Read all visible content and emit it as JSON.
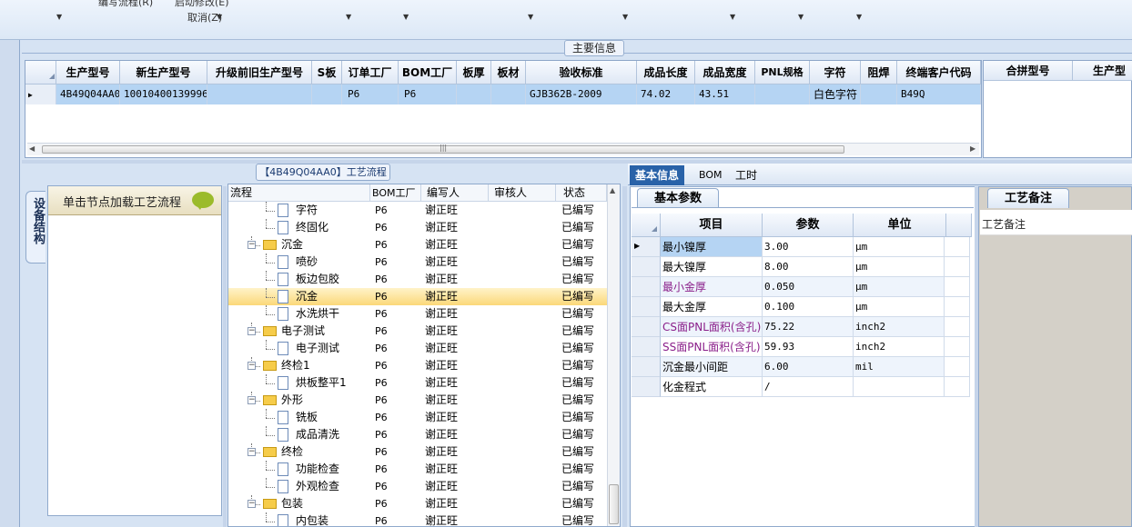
{
  "toolbar": {
    "menu_edit_flow": "编写流程(R)",
    "menu_start_change": "启动修改(E)",
    "menu_cancel": "取消(Z)"
  },
  "main_info": {
    "section_title": "主要信息",
    "columns": [
      "生产型号",
      "新生产型号",
      "升级前旧生产型号",
      "S板",
      "订单工厂",
      "BOM工厂",
      "板厚",
      "板材",
      "验收标准",
      "成品长度",
      "成品宽度",
      "PNL规格",
      "字符",
      "阻焊",
      "终端客户代码"
    ],
    "row": [
      "4B49Q04AA0",
      "10010400139996",
      "",
      "",
      "P6",
      "P6",
      "",
      "",
      "GJB362B-2009",
      "74.02",
      "43.51",
      "",
      "白色字符",
      "",
      "B49Q"
    ],
    "scroll_grip": "|||",
    "right_columns": [
      "合拼型号",
      "生产型"
    ]
  },
  "process": {
    "title": "【4B49Q04AA0】工艺流程",
    "side_tab": "设备结构",
    "load_button": "单击节点加载工艺流程",
    "columns": [
      "流程",
      "BOM工厂",
      "编写人",
      "审核人",
      "状态"
    ],
    "rows": [
      {
        "name": "字符",
        "type": "file",
        "level": 2,
        "bom": "P6",
        "writer": "谢正旺",
        "reviewer": "",
        "status": "已编写"
      },
      {
        "name": "终固化",
        "type": "file",
        "level": 2,
        "bom": "P6",
        "writer": "谢正旺",
        "reviewer": "",
        "status": "已编写"
      },
      {
        "name": "沉金",
        "type": "folder",
        "level": 1,
        "bom": "P6",
        "writer": "谢正旺",
        "reviewer": "",
        "status": "已编写"
      },
      {
        "name": "喷砂",
        "type": "file",
        "level": 2,
        "bom": "P6",
        "writer": "谢正旺",
        "reviewer": "",
        "status": "已编写"
      },
      {
        "name": "板边包胶",
        "type": "file",
        "level": 2,
        "bom": "P6",
        "writer": "谢正旺",
        "reviewer": "",
        "status": "已编写"
      },
      {
        "name": "沉金",
        "type": "file",
        "level": 2,
        "bom": "P6",
        "writer": "谢正旺",
        "reviewer": "",
        "status": "已编写",
        "selected": true
      },
      {
        "name": "水洗烘干",
        "type": "file",
        "level": 2,
        "bom": "P6",
        "writer": "谢正旺",
        "reviewer": "",
        "status": "已编写"
      },
      {
        "name": "电子测试",
        "type": "folder",
        "level": 1,
        "bom": "P6",
        "writer": "谢正旺",
        "reviewer": "",
        "status": "已编写"
      },
      {
        "name": "电子测试",
        "type": "file",
        "level": 2,
        "bom": "P6",
        "writer": "谢正旺",
        "reviewer": "",
        "status": "已编写"
      },
      {
        "name": "终检1",
        "type": "folder",
        "level": 1,
        "bom": "P6",
        "writer": "谢正旺",
        "reviewer": "",
        "status": "已编写"
      },
      {
        "name": "烘板整平1",
        "type": "file",
        "level": 2,
        "bom": "P6",
        "writer": "谢正旺",
        "reviewer": "",
        "status": "已编写"
      },
      {
        "name": "外形",
        "type": "folder",
        "level": 1,
        "bom": "P6",
        "writer": "谢正旺",
        "reviewer": "",
        "status": "已编写"
      },
      {
        "name": "铣板",
        "type": "file",
        "level": 2,
        "bom": "P6",
        "writer": "谢正旺",
        "reviewer": "",
        "status": "已编写"
      },
      {
        "name": "成品清洗",
        "type": "file",
        "level": 2,
        "bom": "P6",
        "writer": "谢正旺",
        "reviewer": "",
        "status": "已编写"
      },
      {
        "name": "终检",
        "type": "folder",
        "level": 1,
        "bom": "P6",
        "writer": "谢正旺",
        "reviewer": "",
        "status": "已编写"
      },
      {
        "name": "功能检查",
        "type": "file",
        "level": 2,
        "bom": "P6",
        "writer": "谢正旺",
        "reviewer": "",
        "status": "已编写"
      },
      {
        "name": "外观检查",
        "type": "file",
        "level": 2,
        "bom": "P6",
        "writer": "谢正旺",
        "reviewer": "",
        "status": "已编写"
      },
      {
        "name": "包装",
        "type": "folder",
        "level": 1,
        "bom": "P6",
        "writer": "谢正旺",
        "reviewer": "",
        "status": "已编写"
      },
      {
        "name": "内包装",
        "type": "file",
        "level": 2,
        "bom": "P6",
        "writer": "谢正旺",
        "reviewer": "",
        "status": "已编写"
      }
    ]
  },
  "detail": {
    "tabs": [
      "基本信息",
      "BOM",
      "工时"
    ],
    "sub_tab": "基本参数",
    "columns": [
      "项目",
      "参数",
      "单位"
    ],
    "rows": [
      {
        "item": "最小镍厚",
        "value": "3.00",
        "unit": "μm",
        "color": "#000000"
      },
      {
        "item": "最大镍厚",
        "value": "8.00",
        "unit": "μm",
        "color": "#000000"
      },
      {
        "item": "最小金厚",
        "value": "0.050",
        "unit": "μm",
        "color": "#8a1f8a"
      },
      {
        "item": "最大金厚",
        "value": "0.100",
        "unit": "μm",
        "color": "#000000"
      },
      {
        "item": "CS面PNL面积(含孔)",
        "value": "75.22",
        "unit": "inch2",
        "color": "#8a1f8a"
      },
      {
        "item": "SS面PNL面积(含孔)",
        "value": "59.93",
        "unit": "inch2",
        "color": "#8a1f8a"
      },
      {
        "item": "沉金最小间距",
        "value": "6.00",
        "unit": "mil",
        "color": "#000000"
      },
      {
        "item": "化金程式",
        "value": "/",
        "unit": "",
        "color": "#000000"
      }
    ]
  },
  "notes": {
    "tab": "工艺备注",
    "label": "工艺备注"
  }
}
